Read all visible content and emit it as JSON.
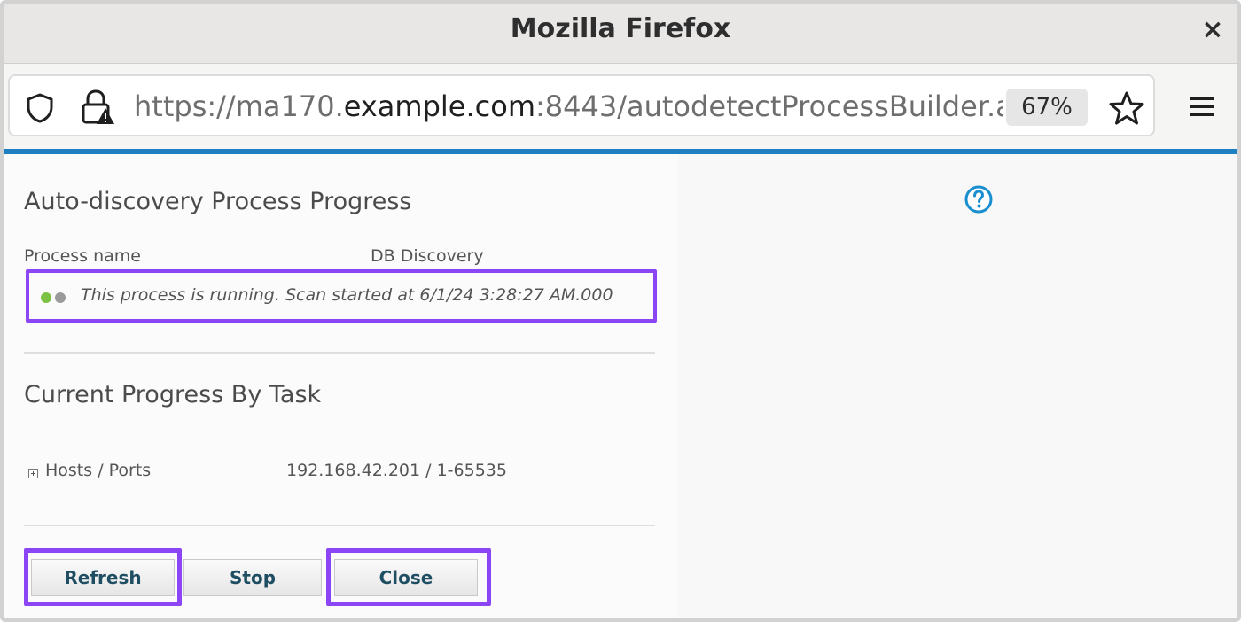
{
  "window": {
    "title": "Mozilla Firefox",
    "close_glyph": "×"
  },
  "toolbar": {
    "url_prefix": "https://ma170.",
    "url_host": "example.com",
    "url_suffix": ":8443/autodetectProcessBuilder.a",
    "zoom": "67%",
    "icons": [
      "shield-icon",
      "insecure-lock-icon",
      "bookmark-star-icon",
      "hamburger-menu-icon"
    ]
  },
  "page": {
    "heading": "Auto-discovery Process Progress",
    "process_name_label": "Process name",
    "process_name_value": "DB Discovery",
    "status_text": "This process is running. Scan started at 6/1/24 3:28:27 AM.000",
    "section_heading": "Current Progress By Task",
    "task_label": "Hosts / Ports",
    "task_value": "192.168.42.201 / 1-65535"
  },
  "buttons": {
    "refresh": "Refresh",
    "stop": "Stop",
    "close": "Close"
  },
  "colors": {
    "accent_line": "#1e7fc1",
    "highlight": "#8b45f5",
    "status_running": "#7cc242",
    "button_text": "#1f4e63",
    "help_icon": "#1a8fd0"
  }
}
